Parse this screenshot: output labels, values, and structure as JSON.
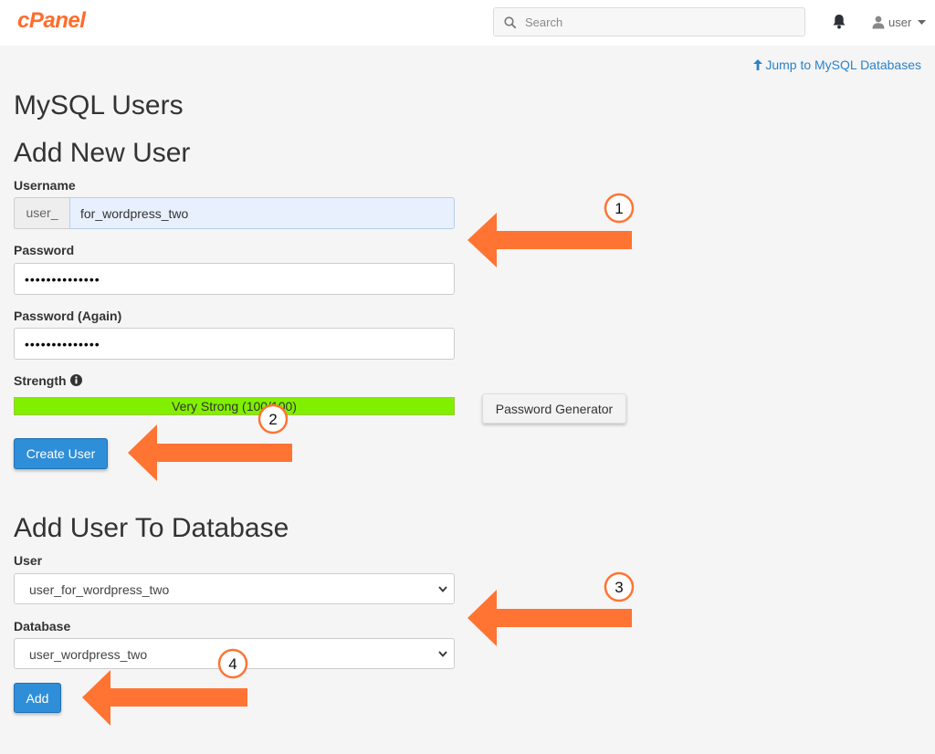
{
  "header": {
    "logo": "cPanel",
    "search_placeholder": "Search",
    "user_label": "user"
  },
  "jump_link": "Jump to MySQL Databases",
  "page_title": "MySQL Users",
  "add_user": {
    "heading": "Add New User",
    "username_label": "Username",
    "username_prefix": "user_",
    "username_value": "for_wordpress_two",
    "password_label": "Password",
    "password_value": "••••••••••••••",
    "password_again_label": "Password (Again)",
    "password_again_value": "••••••••••••••",
    "strength_label": "Strength",
    "strength_text": "Very Strong (100/100)",
    "strength_percent": 100,
    "generator_button": "Password Generator",
    "create_button": "Create User"
  },
  "add_to_db": {
    "heading": "Add User To Database",
    "user_label": "User",
    "user_value": "user_for_wordpress_two",
    "database_label": "Database",
    "database_value": "user_wordpress_two",
    "add_button": "Add"
  },
  "annotations": [
    "1",
    "2",
    "3",
    "4"
  ],
  "colors": {
    "brand": "#ff6c2c",
    "arrow": "#ff7433",
    "primary_button": "#2f8ed8",
    "link": "#2b82c9",
    "strength_bar": "#80f000"
  }
}
